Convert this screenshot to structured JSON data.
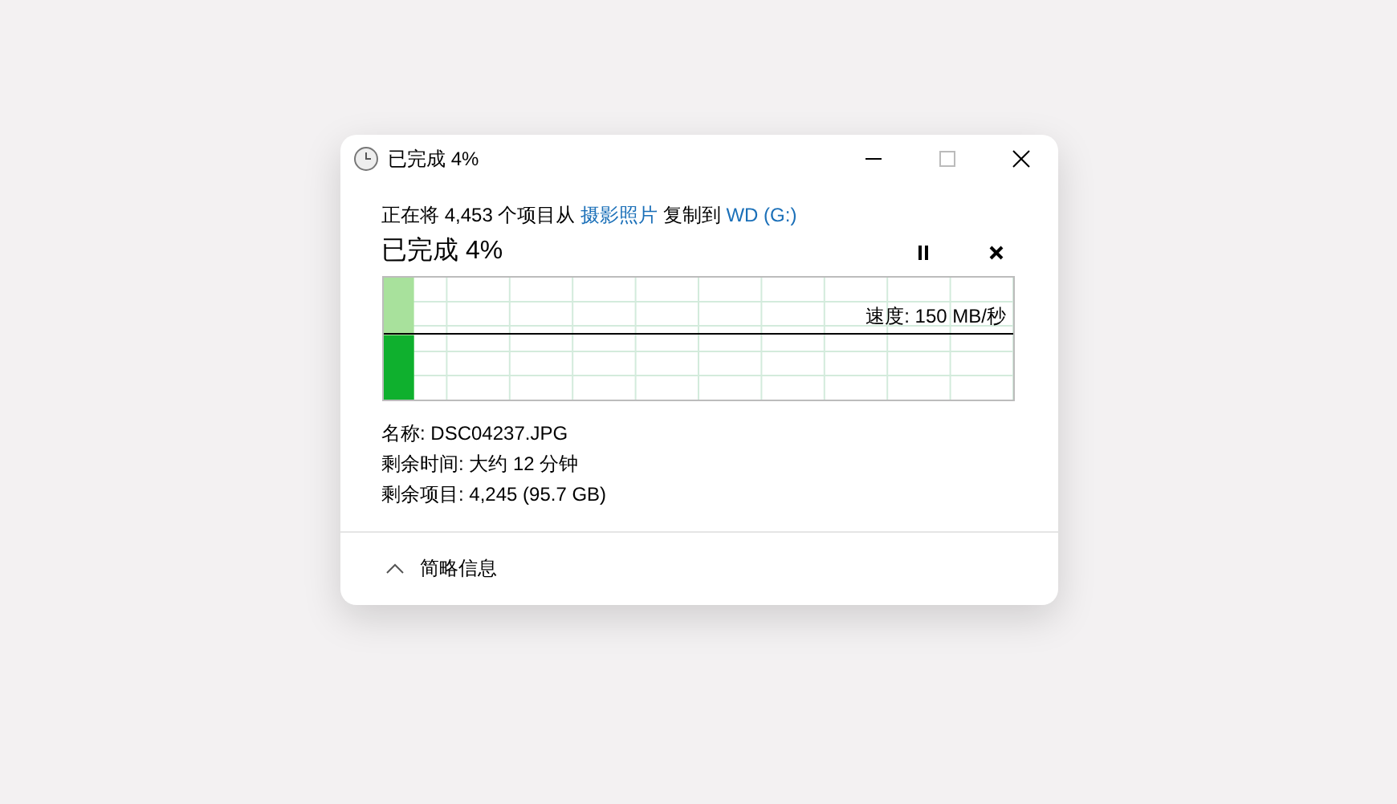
{
  "window": {
    "title": "已完成 4%"
  },
  "description": {
    "prefix": "正在将 4,453 个项目从",
    "source": "摄影照片",
    "middle": "复制到",
    "destination": "WD (G:)"
  },
  "progress": {
    "title": "已完成 4%",
    "level": 0.04,
    "speed": "速度: 150 MB/秒"
  },
  "details": [
    "名称: DSC04237.JPG",
    "剩余时间: 大约 12 分钟",
    "剩余项目: 4,245 (95.7 GB)"
  ],
  "footer": {
    "label": "简略信息",
    "expanded": true
  }
}
